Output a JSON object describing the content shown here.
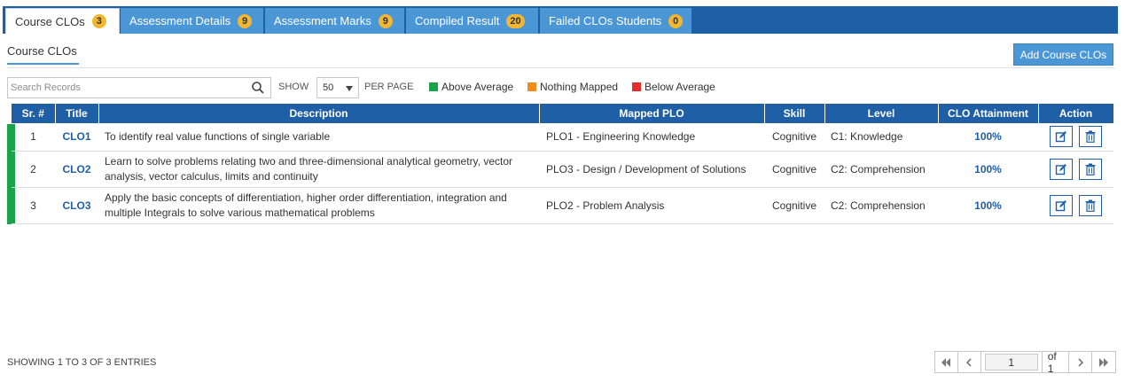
{
  "tabs": [
    {
      "label": "Course CLOs",
      "count": "3"
    },
    {
      "label": "Assessment Details",
      "count": "9"
    },
    {
      "label": "Assessment Marks",
      "count": "9"
    },
    {
      "label": "Compiled Result",
      "count": "20"
    },
    {
      "label": "Failed CLOs Students",
      "count": "0"
    }
  ],
  "section": {
    "title": "Course CLOs",
    "add_button": "Add Course CLOs"
  },
  "toolbar": {
    "search_placeholder": "Search Records",
    "show_label": "SHOW",
    "per_page_value": "50",
    "per_page_label": "PER PAGE"
  },
  "legend": [
    {
      "label": "Above Average",
      "color": "#1aa34a"
    },
    {
      "label": "Nothing Mapped",
      "color": "#f08c1a"
    },
    {
      "label": "Below Average",
      "color": "#e52b2b"
    }
  ],
  "table": {
    "headers": [
      "Sr. #",
      "Title",
      "Description",
      "Mapped PLO",
      "Skill",
      "Level",
      "CLO Attainment",
      "Action"
    ],
    "rows": [
      {
        "sr": "1",
        "title": "CLO1",
        "description": "To identify real value functions of single variable",
        "plo": "PLO1 - Engineering Knowledge",
        "skill": "Cognitive",
        "level": "C1: Knowledge",
        "attainment": "100%",
        "status": "Above Average"
      },
      {
        "sr": "2",
        "title": "CLO2",
        "description": "Learn to solve problems relating two and three-dimensional analytical geometry, vector analysis, vector calculus, limits and continuity",
        "plo": "PLO3 - Design / Development of Solutions",
        "skill": "Cognitive",
        "level": "C2: Comprehension",
        "attainment": "100%",
        "status": "Above Average"
      },
      {
        "sr": "3",
        "title": "CLO3",
        "description": "Apply the basic concepts of differentiation, higher order differentiation, integration and multiple Integrals to solve various mathematical problems",
        "plo": "PLO2 - Problem Analysis",
        "skill": "Cognitive",
        "level": "C2: Comprehension",
        "attainment": "100%",
        "status": "Above Average"
      }
    ]
  },
  "footer": {
    "info": "SHOWING 1 TO 3 OF 3 ENTRIES",
    "page": "1",
    "of_label": "of 1"
  },
  "colors": {
    "primary": "#1f5fa6",
    "tab": "#4b97d6",
    "badge": "#f2b632",
    "status_above": "#1aa34a"
  },
  "icons": {
    "search": "search-icon",
    "edit": "edit-icon",
    "delete": "trash-icon",
    "first": "first-page-icon",
    "prev": "prev-page-icon",
    "next": "next-page-icon",
    "last": "last-page-icon"
  }
}
